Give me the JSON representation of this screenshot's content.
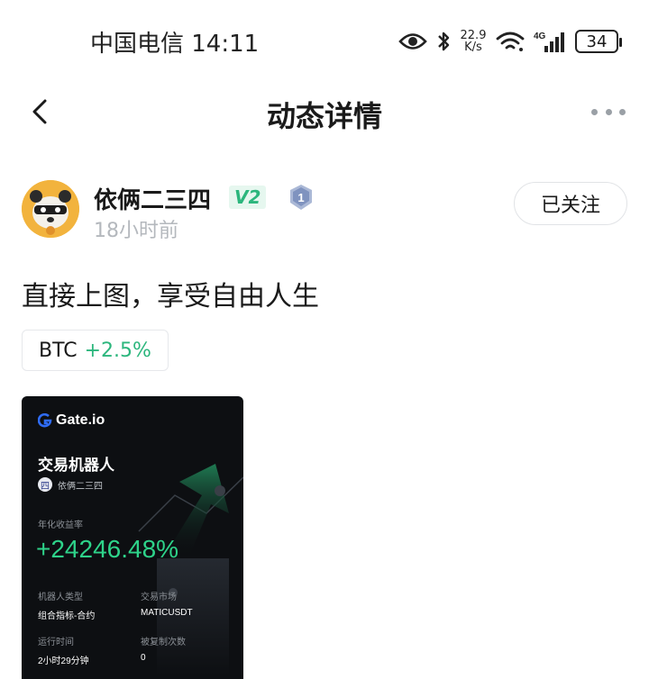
{
  "status_bar": {
    "carrier_time": "中国电信 14:11",
    "net_speed_value": "22.9",
    "net_speed_unit": "K/s",
    "network": "4G",
    "battery": "34"
  },
  "header": {
    "title": "动态详情"
  },
  "author": {
    "name": "依俩二三四",
    "vip": "V2",
    "level": "1",
    "time": "18小时前",
    "follow_label": "已关注"
  },
  "post": {
    "text": "直接上图，享受自由人生"
  },
  "coin_tag": {
    "symbol": "BTC",
    "change": "+2.5%"
  },
  "card": {
    "brand": "Gate.io",
    "title": "交易机器人",
    "user_avatar": "四",
    "user_name": "依俩二三四",
    "return_label": "年化收益率",
    "return_value": "+24246.48%",
    "bot_type_label": "机器人类型",
    "bot_type_value": "组合指标-合约",
    "market_label": "交易市场",
    "market_value": "MATICUSDT",
    "runtime_label": "运行时间",
    "runtime_value": "2小时29分钟",
    "copies_label": "被复制次数",
    "copies_value": "0"
  },
  "colors": {
    "accent_green": "#2cb67d",
    "card_bg": "#0d0f12"
  },
  "icons": [
    "eye-icon",
    "bluetooth-icon",
    "wifi-icon",
    "signal-icon",
    "battery-icon",
    "back-chevron-icon",
    "more-dots-icon",
    "level-shield-icon",
    "gate-logo-icon"
  ]
}
